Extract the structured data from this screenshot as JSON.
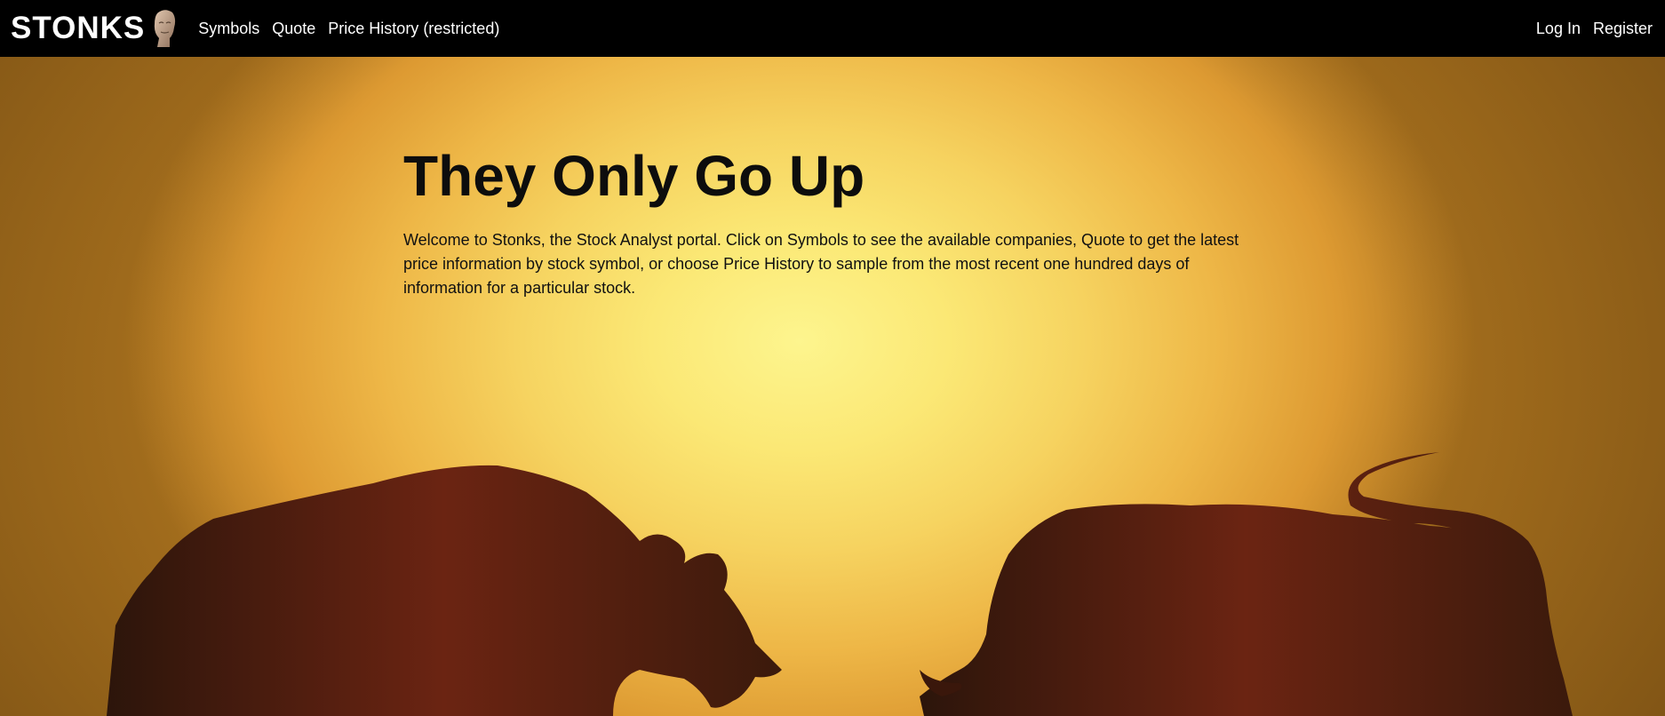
{
  "navbar": {
    "brand": "STONKS",
    "links": [
      {
        "label": "Symbols"
      },
      {
        "label": "Quote"
      },
      {
        "label": "Price History (restricted)"
      }
    ],
    "auth": {
      "login": "Log In",
      "register": "Register"
    }
  },
  "hero": {
    "title": "They Only Go Up",
    "intro": "Welcome to Stonks, the Stock Analyst portal. Click on Symbols to see the available companies, Quote to get the latest price information by stock symbol, or choose Price History to sample from the most recent one hundred days of information for a particular stock."
  },
  "icons": {
    "brand_logo": "meme-head-icon",
    "bear": "bear-silhouette",
    "bull": "bull-silhouette"
  },
  "colors": {
    "navbar_bg": "#000000",
    "nav_text": "#ffffff",
    "hero_glow": "#fdf58e",
    "hero_edge": "#dd9a32",
    "silhouette": "#4a1d10"
  }
}
